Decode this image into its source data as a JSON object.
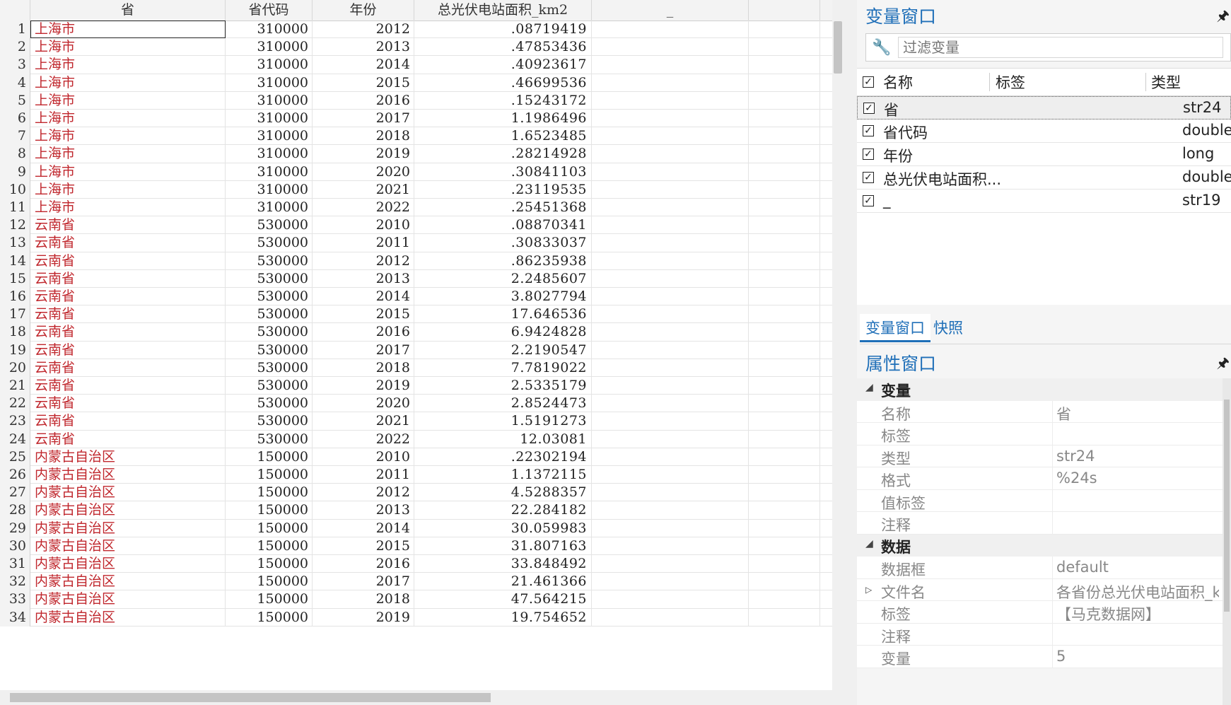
{
  "grid": {
    "columns": [
      "省",
      "省代码",
      "年份",
      "总光伏电站面积_km2",
      "_"
    ],
    "rows": [
      {
        "n": "1",
        "prov": "上海市",
        "code": "310000",
        "year": "2012",
        "area": ".08719419"
      },
      {
        "n": "2",
        "prov": "上海市",
        "code": "310000",
        "year": "2013",
        "area": ".47853436"
      },
      {
        "n": "3",
        "prov": "上海市",
        "code": "310000",
        "year": "2014",
        "area": ".40923617"
      },
      {
        "n": "4",
        "prov": "上海市",
        "code": "310000",
        "year": "2015",
        "area": ".46699536"
      },
      {
        "n": "5",
        "prov": "上海市",
        "code": "310000",
        "year": "2016",
        "area": ".15243172"
      },
      {
        "n": "6",
        "prov": "上海市",
        "code": "310000",
        "year": "2017",
        "area": "1.1986496"
      },
      {
        "n": "7",
        "prov": "上海市",
        "code": "310000",
        "year": "2018",
        "area": "1.6523485"
      },
      {
        "n": "8",
        "prov": "上海市",
        "code": "310000",
        "year": "2019",
        "area": ".28214928"
      },
      {
        "n": "9",
        "prov": "上海市",
        "code": "310000",
        "year": "2020",
        "area": ".30841103"
      },
      {
        "n": "10",
        "prov": "上海市",
        "code": "310000",
        "year": "2021",
        "area": ".23119535"
      },
      {
        "n": "11",
        "prov": "上海市",
        "code": "310000",
        "year": "2022",
        "area": ".25451368"
      },
      {
        "n": "12",
        "prov": "云南省",
        "code": "530000",
        "year": "2010",
        "area": ".08870341"
      },
      {
        "n": "13",
        "prov": "云南省",
        "code": "530000",
        "year": "2011",
        "area": ".30833037"
      },
      {
        "n": "14",
        "prov": "云南省",
        "code": "530000",
        "year": "2012",
        "area": ".86235938"
      },
      {
        "n": "15",
        "prov": "云南省",
        "code": "530000",
        "year": "2013",
        "area": "2.2485607"
      },
      {
        "n": "16",
        "prov": "云南省",
        "code": "530000",
        "year": "2014",
        "area": "3.8027794"
      },
      {
        "n": "17",
        "prov": "云南省",
        "code": "530000",
        "year": "2015",
        "area": "17.646536"
      },
      {
        "n": "18",
        "prov": "云南省",
        "code": "530000",
        "year": "2016",
        "area": "6.9424828"
      },
      {
        "n": "19",
        "prov": "云南省",
        "code": "530000",
        "year": "2017",
        "area": "2.2190547"
      },
      {
        "n": "20",
        "prov": "云南省",
        "code": "530000",
        "year": "2018",
        "area": "7.7819022"
      },
      {
        "n": "21",
        "prov": "云南省",
        "code": "530000",
        "year": "2019",
        "area": "2.5335179"
      },
      {
        "n": "22",
        "prov": "云南省",
        "code": "530000",
        "year": "2020",
        "area": "2.8524473"
      },
      {
        "n": "23",
        "prov": "云南省",
        "code": "530000",
        "year": "2021",
        "area": "1.5191273"
      },
      {
        "n": "24",
        "prov": "云南省",
        "code": "530000",
        "year": "2022",
        "area": "12.03081"
      },
      {
        "n": "25",
        "prov": "内蒙古自治区",
        "code": "150000",
        "year": "2010",
        "area": ".22302194"
      },
      {
        "n": "26",
        "prov": "内蒙古自治区",
        "code": "150000",
        "year": "2011",
        "area": "1.1372115"
      },
      {
        "n": "27",
        "prov": "内蒙古自治区",
        "code": "150000",
        "year": "2012",
        "area": "4.5288357"
      },
      {
        "n": "28",
        "prov": "内蒙古自治区",
        "code": "150000",
        "year": "2013",
        "area": "22.284182"
      },
      {
        "n": "29",
        "prov": "内蒙古自治区",
        "code": "150000",
        "year": "2014",
        "area": "30.059983"
      },
      {
        "n": "30",
        "prov": "内蒙古自治区",
        "code": "150000",
        "year": "2015",
        "area": "31.807163"
      },
      {
        "n": "31",
        "prov": "内蒙古自治区",
        "code": "150000",
        "year": "2016",
        "area": "33.848492"
      },
      {
        "n": "32",
        "prov": "内蒙古自治区",
        "code": "150000",
        "year": "2017",
        "area": "21.461366"
      },
      {
        "n": "33",
        "prov": "内蒙古自治区",
        "code": "150000",
        "year": "2018",
        "area": "47.564215"
      },
      {
        "n": "34",
        "prov": "内蒙古自治区",
        "code": "150000",
        "year": "2019",
        "area": "19.754652"
      }
    ]
  },
  "variables_panel": {
    "title": "变量窗口",
    "filter_placeholder": "过滤变量",
    "headers": {
      "name": "名称",
      "label": "标签",
      "type": "类型"
    },
    "vars": [
      {
        "name": "省",
        "type": "str24"
      },
      {
        "name": "省代码",
        "type": "double"
      },
      {
        "name": "年份",
        "type": "long"
      },
      {
        "name": "总光伏电站面积...",
        "type": "double"
      },
      {
        "name": "_",
        "type": "str19"
      }
    ],
    "tabs": [
      "变量窗口",
      "快照"
    ]
  },
  "properties_panel": {
    "title": "属性窗口",
    "groups": {
      "variable": {
        "label": "变量",
        "rows": [
          {
            "k": "名称",
            "v": "省"
          },
          {
            "k": "标签",
            "v": ""
          },
          {
            "k": "类型",
            "v": "str24"
          },
          {
            "k": "格式",
            "v": "%24s"
          },
          {
            "k": "值标签",
            "v": ""
          },
          {
            "k": "注释",
            "v": ""
          }
        ]
      },
      "data": {
        "label": "数据",
        "rows": [
          {
            "k": "数据框",
            "v": "default"
          },
          {
            "k": "文件名",
            "v": "各省份总光伏电站面积_k"
          },
          {
            "k": "标签",
            "v": "【马克数据网】"
          },
          {
            "k": "注释",
            "v": ""
          },
          {
            "k": "变量",
            "v": "5"
          }
        ]
      }
    }
  },
  "colors": {
    "accent_blue": "#1f6fb8",
    "string_red": "#c0272d"
  },
  "icons": [
    "wrench-icon",
    "pin-icon",
    "checkbox-icon",
    "collapse-triangle-icon",
    "expand-triangle-icon"
  ]
}
